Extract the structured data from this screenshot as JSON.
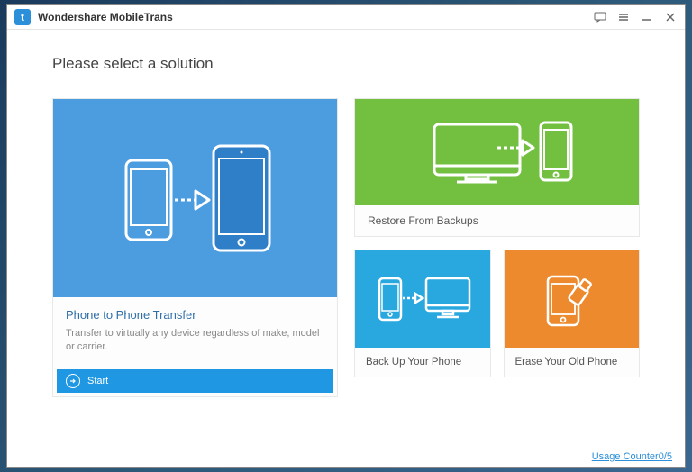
{
  "app": {
    "title": "Wondershare MobileTrans"
  },
  "heading": "Please select a solution",
  "cards": {
    "main": {
      "title": "Phone to Phone Transfer",
      "desc": "Transfer to virtually any device regardless of make, model or carrier.",
      "start": "Start"
    },
    "restore": {
      "title": "Restore From Backups"
    },
    "backup": {
      "title": "Back Up Your Phone"
    },
    "erase": {
      "title": "Erase Your Old Phone"
    }
  },
  "footer": {
    "usage": "Usage Counter0/5"
  },
  "colors": {
    "blue_card": "#4c9de0",
    "green_card": "#73c040",
    "cyan_card": "#29a7df",
    "orange_card": "#ed8a2e",
    "accent": "#1f97e3"
  }
}
